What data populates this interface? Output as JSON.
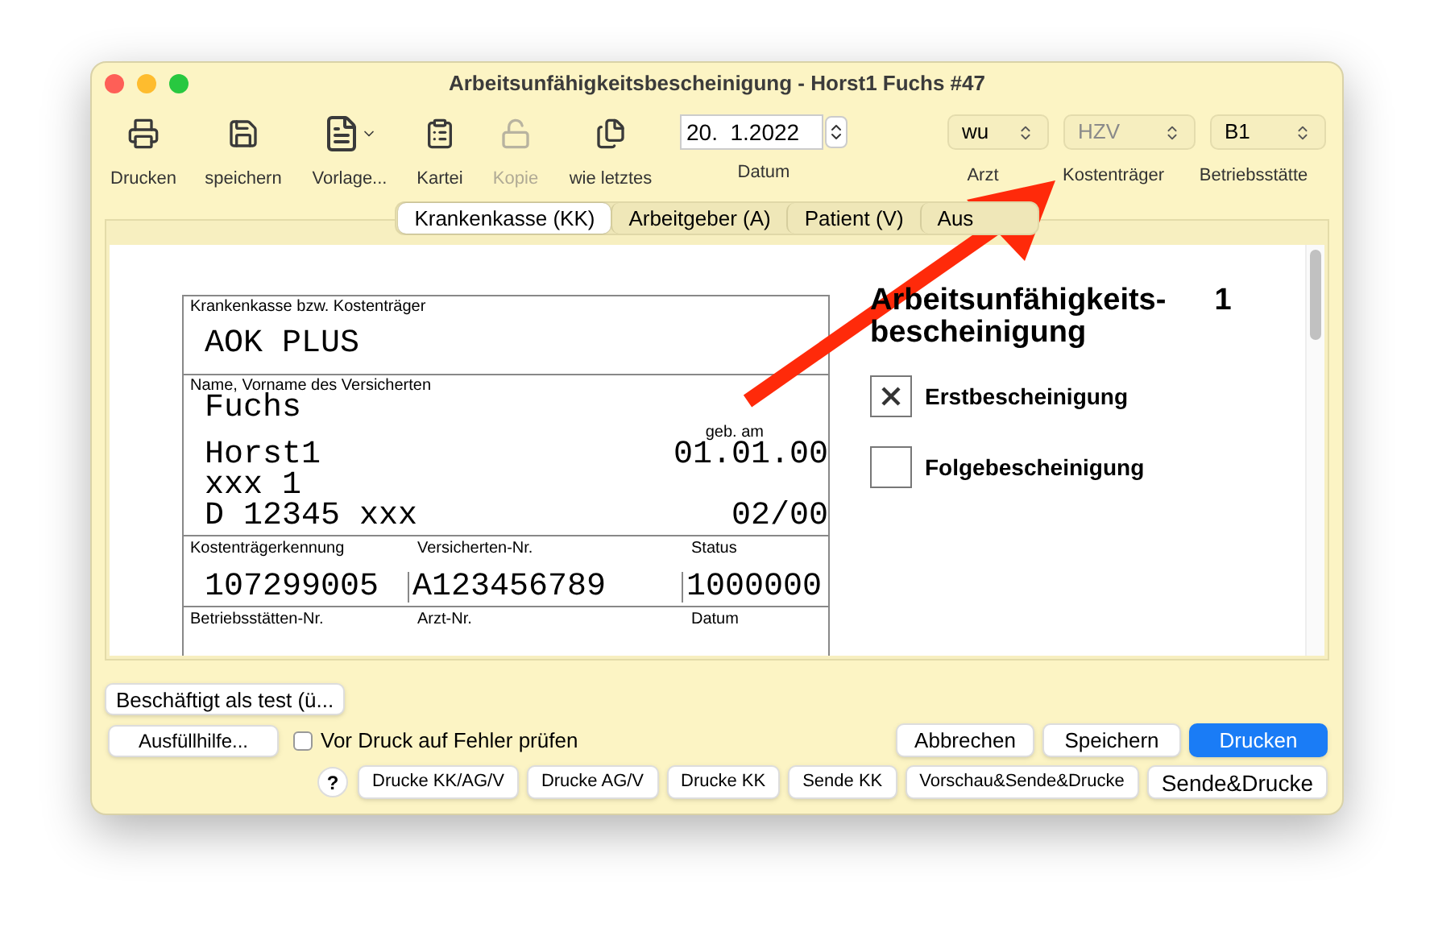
{
  "window": {
    "title": "Arbeitsunfähigkeitsbescheinigung -  Horst1 Fuchs #47"
  },
  "toolbar": {
    "items": [
      {
        "label": "Drucken",
        "kind": "printer",
        "disabled": false
      },
      {
        "label": "speichern",
        "kind": "save",
        "disabled": false
      },
      {
        "label": "Vorlage...",
        "kind": "template",
        "disabled": false
      },
      {
        "label": "Kartei",
        "kind": "clipboard",
        "disabled": false
      },
      {
        "label": "Kopie",
        "kind": "lock",
        "disabled": true
      },
      {
        "label": "wie letztes",
        "kind": "document",
        "disabled": false
      }
    ],
    "date": {
      "value": "20.  1.2022",
      "label": "Datum"
    },
    "popups": [
      {
        "value": "wu",
        "label": "Arzt",
        "disabled": false
      },
      {
        "value": "HZV",
        "label": "Kostenträger",
        "disabled": true
      },
      {
        "value": "B1",
        "label": "Betriebsstätte",
        "disabled": false
      }
    ]
  },
  "tabs": [
    {
      "label": "Krankenkasse (KK)",
      "selected": true
    },
    {
      "label": "Arbeitgeber (A)",
      "selected": false
    },
    {
      "label": "Patient (V)",
      "selected": false
    },
    {
      "label": "Aus",
      "selected": false
    }
  ],
  "form": {
    "insurer_label": "Krankenkasse bzw. Kostenträger",
    "insurer": "AOK PLUS",
    "name_label": "Name, Vorname des Versicherten",
    "surname": "Fuchs",
    "first_name": "Horst1",
    "birth_label": "geb. am",
    "birth_date": "01.01.00",
    "street": "xxx 1",
    "city": "D 12345 xxx",
    "valid": "02/00",
    "row_1": [
      {
        "label": "Kostenträgerkennung",
        "value": "107299005"
      },
      {
        "label": "Versicherten-Nr.",
        "value": "A123456789"
      },
      {
        "label": "Status",
        "value": "1000000"
      }
    ],
    "row_2": [
      {
        "label": "Betriebsstätten-Nr."
      },
      {
        "label": "Arzt-Nr."
      },
      {
        "label": "Datum"
      }
    ],
    "heading": "Arbeitsunfähigkeits-\nbescheinigung",
    "page": "1",
    "checkboxes": [
      {
        "label": "Erstbescheinigung",
        "checked": true
      },
      {
        "label": "Folgebescheinigung",
        "checked": false
      }
    ]
  },
  "bottom": {
    "employment": "Beschäftigt als test (ü...",
    "help": "Ausfüllhilfe...",
    "check": {
      "label": "Vor Druck auf Fehler prüfen",
      "checked": false
    },
    "actions": [
      {
        "label": "Abbrechen",
        "primary": false
      },
      {
        "label": "Speichern",
        "primary": false
      },
      {
        "label": "Drucken",
        "primary": true
      }
    ],
    "help_mark": "?",
    "send_buttons": [
      "Drucke KK/AG/V",
      "Drucke AG/V",
      "Drucke KK",
      "Sende KK",
      "Vorschau&Sende&Drucke",
      "Sende&Drucke"
    ]
  }
}
